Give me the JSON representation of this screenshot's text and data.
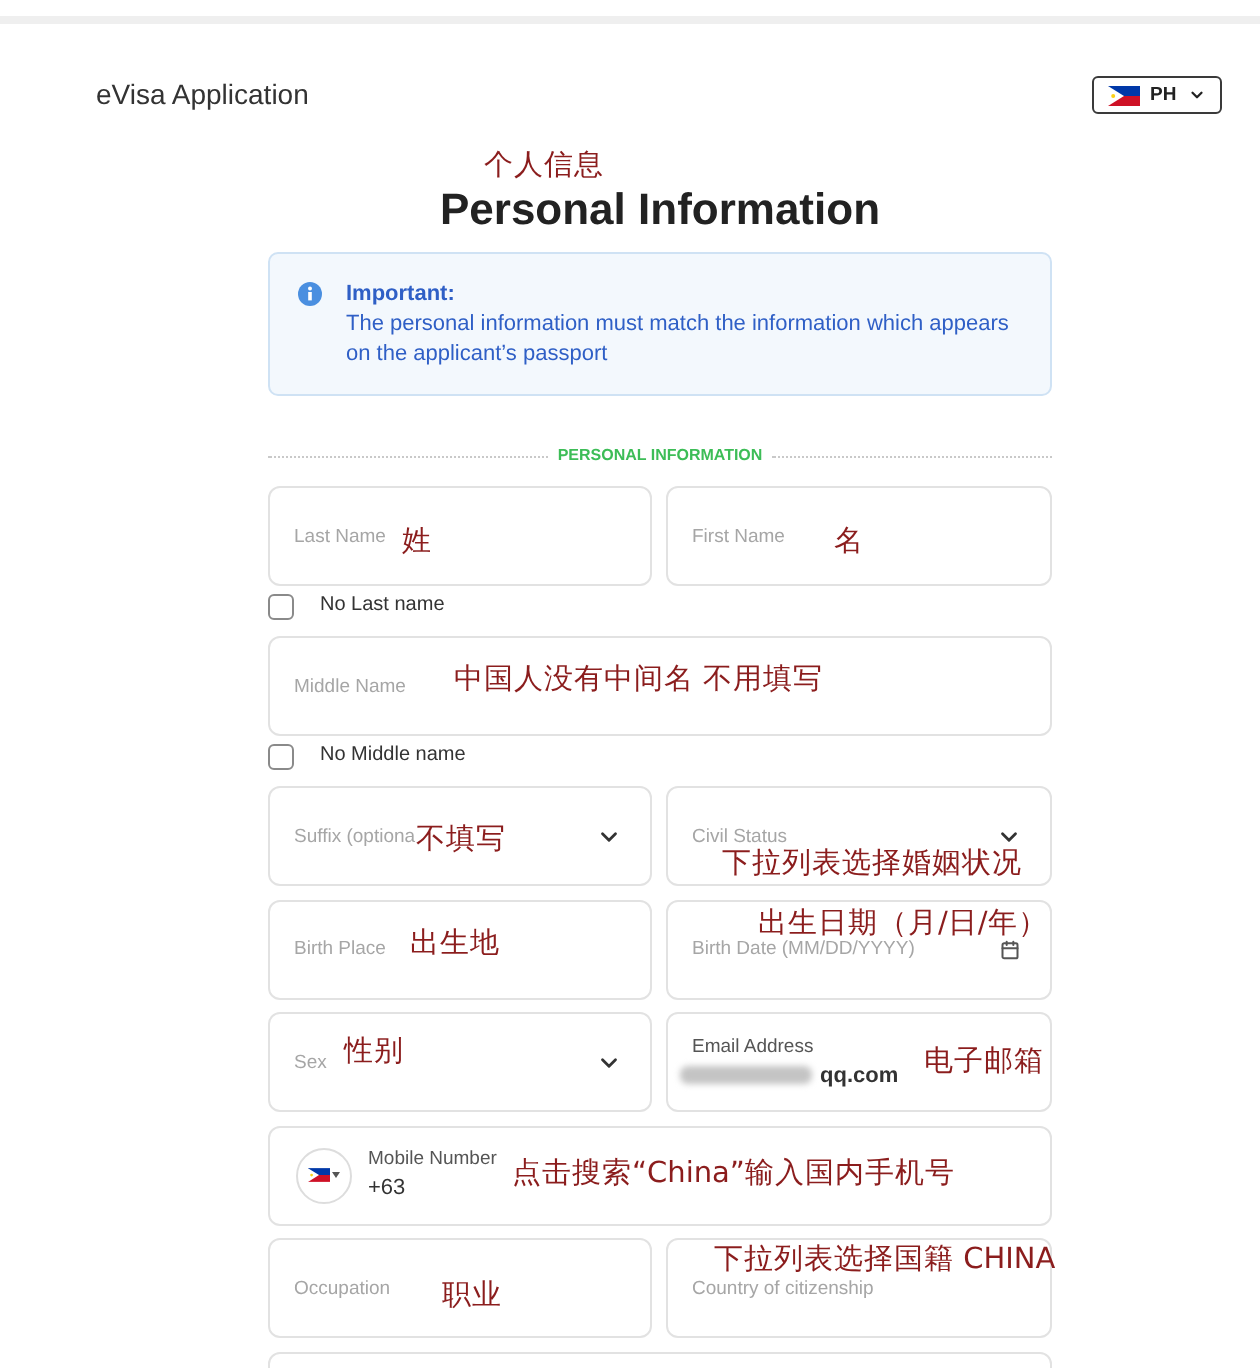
{
  "header": {
    "title": "eVisa Application",
    "language": {
      "code": "PH"
    }
  },
  "page": {
    "title": "Personal Information",
    "annotation": "个人信息"
  },
  "notice": {
    "heading": "Important:",
    "text": "The personal information must match the information which appears on the applicant’s passport"
  },
  "section": {
    "title": "PERSONAL INFORMATION"
  },
  "form": {
    "rows": [
      {
        "fields": [
          {
            "kind": "text",
            "label": "Last Name",
            "annotation": "姓"
          },
          {
            "kind": "text",
            "label": "First Name",
            "annotation": "名"
          }
        ]
      },
      {
        "fields": [
          {
            "kind": "checkbox",
            "label": "No Last name",
            "checked": false
          }
        ]
      },
      {
        "fields": [
          {
            "kind": "text",
            "label": "Middle Name",
            "annotation": "中国人没有中间名 不用填写"
          }
        ]
      },
      {
        "fields": [
          {
            "kind": "checkbox",
            "label": "No Middle name",
            "checked": false
          }
        ]
      },
      {
        "fields": [
          {
            "kind": "select",
            "label": "Suffix (optiona",
            "annotation": "不填写"
          },
          {
            "kind": "select",
            "label": "Civil Status",
            "annotation": "下拉列表选择婚姻状况"
          }
        ]
      },
      {
        "fields": [
          {
            "kind": "text",
            "label": "Birth Place",
            "annotation": "出生地"
          },
          {
            "kind": "date",
            "label": "Birth Date (MM/DD/YYYY)",
            "annotation": "出生日期（月/日/年）"
          }
        ]
      },
      {
        "fields": [
          {
            "kind": "select",
            "label": "Sex",
            "annotation": "性别"
          },
          {
            "kind": "text",
            "label": "Email Address",
            "value": "qq.com",
            "redacted": true,
            "annotation": "电子邮箱"
          }
        ]
      },
      {
        "fields": [
          {
            "kind": "phone",
            "label": "Mobile Number",
            "value": "+63",
            "annotation": "点击搜索“China”输入国内手机号"
          }
        ]
      },
      {
        "fields": [
          {
            "kind": "text",
            "label": "Occupation",
            "annotation": "职业"
          },
          {
            "kind": "text",
            "label": "Country of citizenship",
            "annotation": "下拉列表选择国籍 CHINA"
          }
        ]
      },
      {
        "fields": [
          {
            "kind": "text"
          }
        ]
      }
    ]
  }
}
